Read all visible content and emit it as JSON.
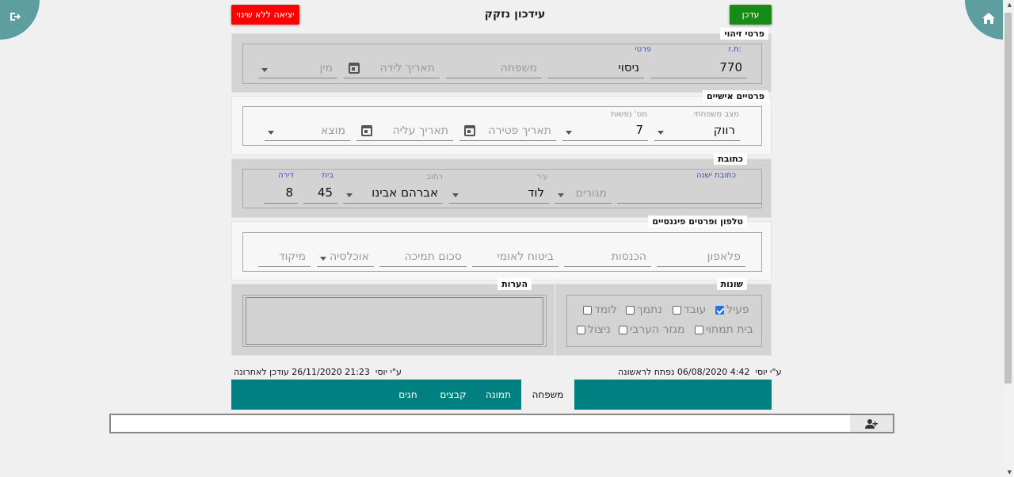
{
  "header": {
    "title": "עידכון נזקק",
    "exit_button": "יציאה ללא שינוי",
    "update_button": "עדכן"
  },
  "identity": {
    "legend": "פרטי זיהוי",
    "id_label": "ת.ז:",
    "id_value": "770",
    "first_label": "פרטי",
    "first_value": "ניסוי",
    "last_placeholder": "משפחה",
    "birth_placeholder": "תאריך לידה",
    "gender_placeholder": "מין"
  },
  "personal": {
    "legend": "פרטיים אישיים",
    "marital_label": "מצב משפחתי",
    "marital_value": "רווק",
    "souls_label": "מס' נפשות",
    "souls_value": "7",
    "death_placeholder": "תאריך פטירה",
    "aliyah_placeholder": "תאריך עליה",
    "origin_placeholder": "מוצא"
  },
  "address": {
    "legend": "כתובת",
    "old_label": "כתובת ישנה",
    "residence_placeholder": "מגורים",
    "city_label": "עיר",
    "city_value": "לוד",
    "street_label": "רחוב",
    "street_value": "אברהם אבינו",
    "house_label": "בית",
    "house_value": "45",
    "apt_label": "דירה",
    "apt_value": "8"
  },
  "finance": {
    "legend": "טלפון ופרטים פיננסיים",
    "mobile_placeholder": "פלאפון",
    "income_placeholder": "הכנסות",
    "nii_placeholder": "ביטוח לאומי",
    "support_placeholder": "סכום תמיכה",
    "population_placeholder": "אוכלסיה",
    "zip_placeholder": "מיקוד"
  },
  "misc": {
    "legend": "שונות",
    "active": "פעיל",
    "worker": "עובד",
    "supported": "נתמך",
    "student": "לומד",
    "home_care": "בית תמחוי",
    "arab_sector": "מגזר הערבי",
    "survivor": "ניצול"
  },
  "notes": {
    "legend": "הערות"
  },
  "meta": {
    "opened_label": "נפתח לראשונה",
    "opened_date": "06/08/2020",
    "opened_time": "4:42",
    "opened_by": "ע\"י יוסי",
    "updated_label": "עודכן לאחרונה",
    "updated_date": "26/11/2020",
    "updated_time": "21:23",
    "updated_by": "ע\"י יוסי"
  },
  "tabs": [
    "משפחה",
    "תמונה",
    "קבצים",
    "חגים"
  ],
  "icons": {
    "home": "home-icon",
    "logout": "logout-icon",
    "add_person": "add-person-icon"
  },
  "colors": {
    "exit": "#ff0000",
    "update": "#168c16",
    "teal": "#008080",
    "corner": "#5f9ea0"
  }
}
